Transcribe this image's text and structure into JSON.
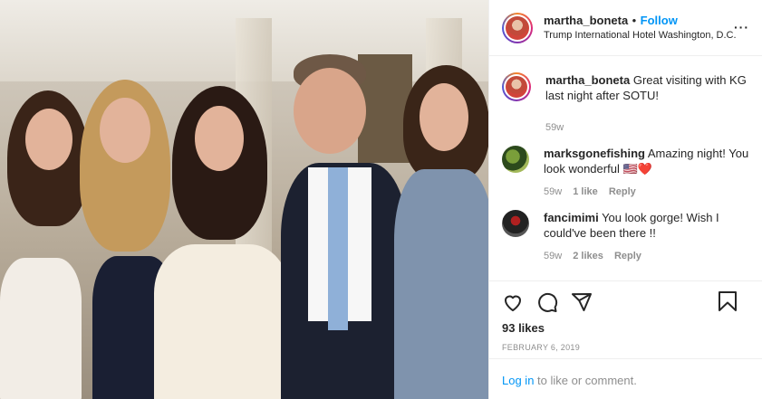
{
  "post": {
    "username": "martha_boneta",
    "separator": "•",
    "follow_label": "Follow",
    "location": "Trump International Hotel Washington, D.C.",
    "more_label": "···"
  },
  "comments": [
    {
      "username": "martha_boneta",
      "text": "Great visiting with KG last night after SOTU!",
      "age": "59w",
      "likes": "",
      "reply": ""
    },
    {
      "username": "marksgonefishing",
      "text": "Amazing night! You look wonderful 🇺🇸❤️",
      "age": "59w",
      "likes": "1 like",
      "reply": "Reply"
    },
    {
      "username": "fancimimi",
      "text": "You look gorge! Wish I could've been there !!",
      "age": "59w",
      "likes": "2 likes",
      "reply": "Reply"
    }
  ],
  "actions": {
    "like_icon": "heart-icon",
    "comment_icon": "comment-icon",
    "share_icon": "share-icon",
    "save_icon": "bookmark-icon",
    "likes_count": "93 likes",
    "date": "FEBRUARY 6, 2019"
  },
  "login": {
    "link": "Log in",
    "rest": " to like or comment."
  },
  "colors": {
    "link_blue": "#0095f6",
    "muted": "#8e8e8e",
    "border": "#efefef",
    "text": "#262626"
  }
}
